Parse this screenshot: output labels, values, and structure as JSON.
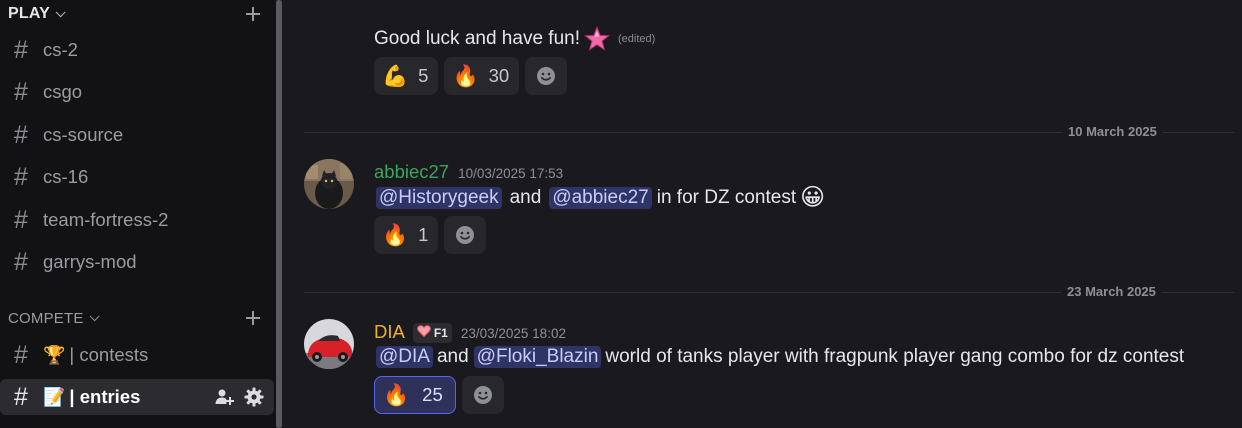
{
  "sidebar": {
    "play_category": "PLAY",
    "play_channels": [
      {
        "name": "cs-2"
      },
      {
        "name": "csgo"
      },
      {
        "name": "cs-source"
      },
      {
        "name": "cs-16"
      },
      {
        "name": "team-fortress-2"
      },
      {
        "name": "garrys-mod"
      }
    ],
    "compete_category": "COMPETE",
    "compete_channels": [
      {
        "emoji": "🏆",
        "name": "| contests"
      },
      {
        "emoji": "📝",
        "name": "| entries",
        "active": true
      }
    ]
  },
  "chat": {
    "msg1": {
      "text": "Good luck and have fun!",
      "edited": "(edited)",
      "reactions": [
        {
          "emoji": "💪",
          "count": "5"
        },
        {
          "emoji": "🔥",
          "count": "30"
        }
      ]
    },
    "divider1": "10 March 2025",
    "msg2": {
      "author": "abbiec27",
      "author_color": "#3ba55c",
      "timestamp": "10/03/2025 17:53",
      "mention1": "@Historygeek",
      "mid": "and",
      "mention2": "@abbiec27",
      "tail": "in for DZ contest",
      "emoji": "😀",
      "reactions": [
        {
          "emoji": "🔥",
          "count": "1"
        }
      ]
    },
    "divider2": "23 March 2025",
    "msg3": {
      "author": "DIA",
      "author_color": "#f0b132",
      "tag": "F1",
      "timestamp": "23/03/2025 18:02",
      "mention1": "@DIA",
      "mid": "and",
      "mention2": "@Floki_Blazin",
      "tail": "world of tanks player with fragpunk player gang combo for dz contest",
      "reactions": [
        {
          "emoji": "🔥",
          "count": "25"
        }
      ]
    }
  }
}
